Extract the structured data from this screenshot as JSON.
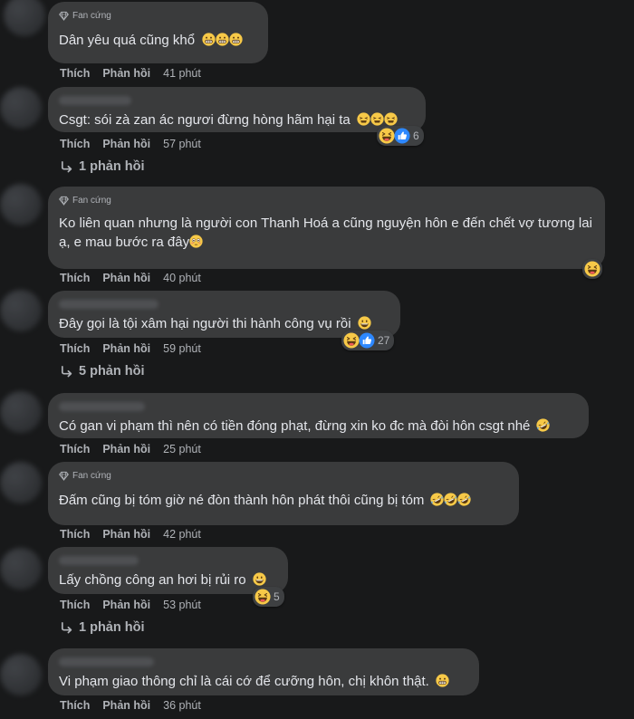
{
  "badge_label": "Fan cứng",
  "actions": {
    "like": "Thích",
    "reply": "Phản hồi"
  },
  "colors": {
    "background": "#18191a",
    "bubble": "#3a3b3c",
    "like_blue": "#2d88ff",
    "emoji_yellow": "#f7c948"
  },
  "comments": [
    {
      "fan": true,
      "text": "Dân yêu quá cũng khổ",
      "emojis": [
        "grimace-emoji",
        "grimace-emoji",
        "grimace-emoji"
      ],
      "time": "41 phút"
    },
    {
      "fan": false,
      "text": "Csgt: sói zà zan ác ngươi đừng hòng hãm hại ta",
      "emojis": [
        "tired-emoji",
        "tired-emoji",
        "tired-emoji"
      ],
      "time": "57 phút",
      "reactions": [
        "haha",
        "like"
      ],
      "reaction_count": "6"
    },
    {
      "fan": true,
      "text": "Ko liên quan nhưng là người con Thanh Hoá a cũng nguyện hôn e đến chết vợ tương lai ạ, e mau bước ra đây",
      "emojis": [
        "flushed-emoji"
      ],
      "time": "40 phút",
      "reactions": [
        "haha"
      ]
    },
    {
      "fan": false,
      "text": "Đây gọi là tội xâm hại người thi hành công vụ rồi",
      "emojis": [
        "grin-emoji"
      ],
      "time": "59 phút",
      "reactions": [
        "haha",
        "like"
      ],
      "reaction_count": "27"
    },
    {
      "fan": false,
      "text": "Có gan vi phạm thì nên có tiền đóng phạt, đừng xin ko đc mà đòi hôn csgt nhé",
      "emojis": [
        "rofl-emoji"
      ],
      "time": "25 phút"
    },
    {
      "fan": true,
      "text": "Đấm cũng bị tóm giờ né đòn thành hôn phát thôi cũng bị tóm",
      "emojis": [
        "rofl-emoji",
        "rofl-emoji",
        "rofl-emoji"
      ],
      "time": "42 phút"
    },
    {
      "fan": false,
      "text": "Lấy chồng công an hơi bị rủi ro",
      "emojis": [
        "grin-emoji"
      ],
      "time": "53 phút",
      "reactions": [
        "haha"
      ],
      "reaction_count": "5"
    },
    {
      "fan": false,
      "text": "Vi phạm giao thông chỉ là cái cớ để cưỡng hôn, chị khôn thật.",
      "emojis": [
        "grimace-emoji"
      ],
      "time": "36 phút"
    }
  ],
  "reply_links": [
    {
      "label": "1 phản hồi"
    },
    {
      "label": "5 phản hồi"
    },
    {
      "label": "1 phản hồi"
    }
  ]
}
